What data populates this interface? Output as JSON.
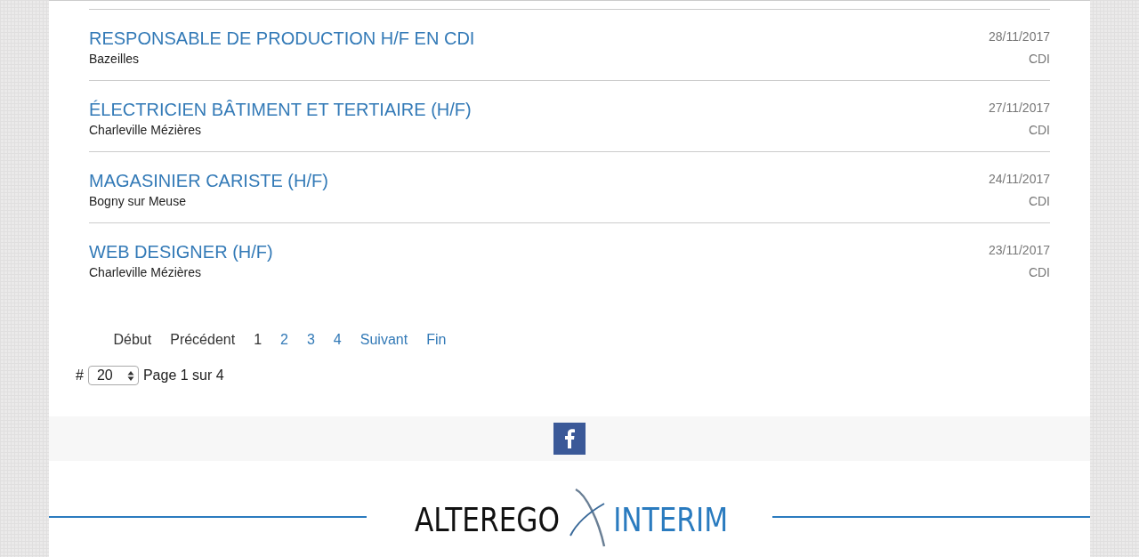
{
  "jobs": [
    {
      "title": "RESPONSABLE DE PRODUCTION H/F EN CDI",
      "location": "Bazeilles",
      "date": "28/11/2017",
      "contract": "CDI"
    },
    {
      "title": "ÉLECTRICIEN BÂTIMENT ET TERTIAIRE (H/F)",
      "location": "Charleville Mézières",
      "date": "27/11/2017",
      "contract": "CDI"
    },
    {
      "title": "MAGASINIER CARISTE (H/F)",
      "location": "Bogny sur Meuse",
      "date": "24/11/2017",
      "contract": "CDI"
    },
    {
      "title": "WEB DESIGNER (H/F)",
      "location": "Charleville Mézières",
      "date": "23/11/2017",
      "contract": "CDI"
    }
  ],
  "pagination": [
    {
      "label": "Début",
      "kind": "nav",
      "disabled": true
    },
    {
      "label": "Précédent",
      "kind": "nav",
      "disabled": true
    },
    {
      "label": "1",
      "kind": "page",
      "selected": true
    },
    {
      "label": "2",
      "kind": "page",
      "selected": false
    },
    {
      "label": "3",
      "kind": "page",
      "selected": false
    },
    {
      "label": "4",
      "kind": "page",
      "selected": false
    },
    {
      "label": "Suivant",
      "kind": "nav",
      "disabled": false
    },
    {
      "label": "Fin",
      "kind": "nav",
      "disabled": false
    }
  ],
  "page_size": {
    "prefix": "#",
    "value": "20",
    "summary": "Page 1 sur 4"
  },
  "footer": {
    "logo": {
      "left": "ALTEREGO",
      "right": "INTERIM"
    }
  }
}
